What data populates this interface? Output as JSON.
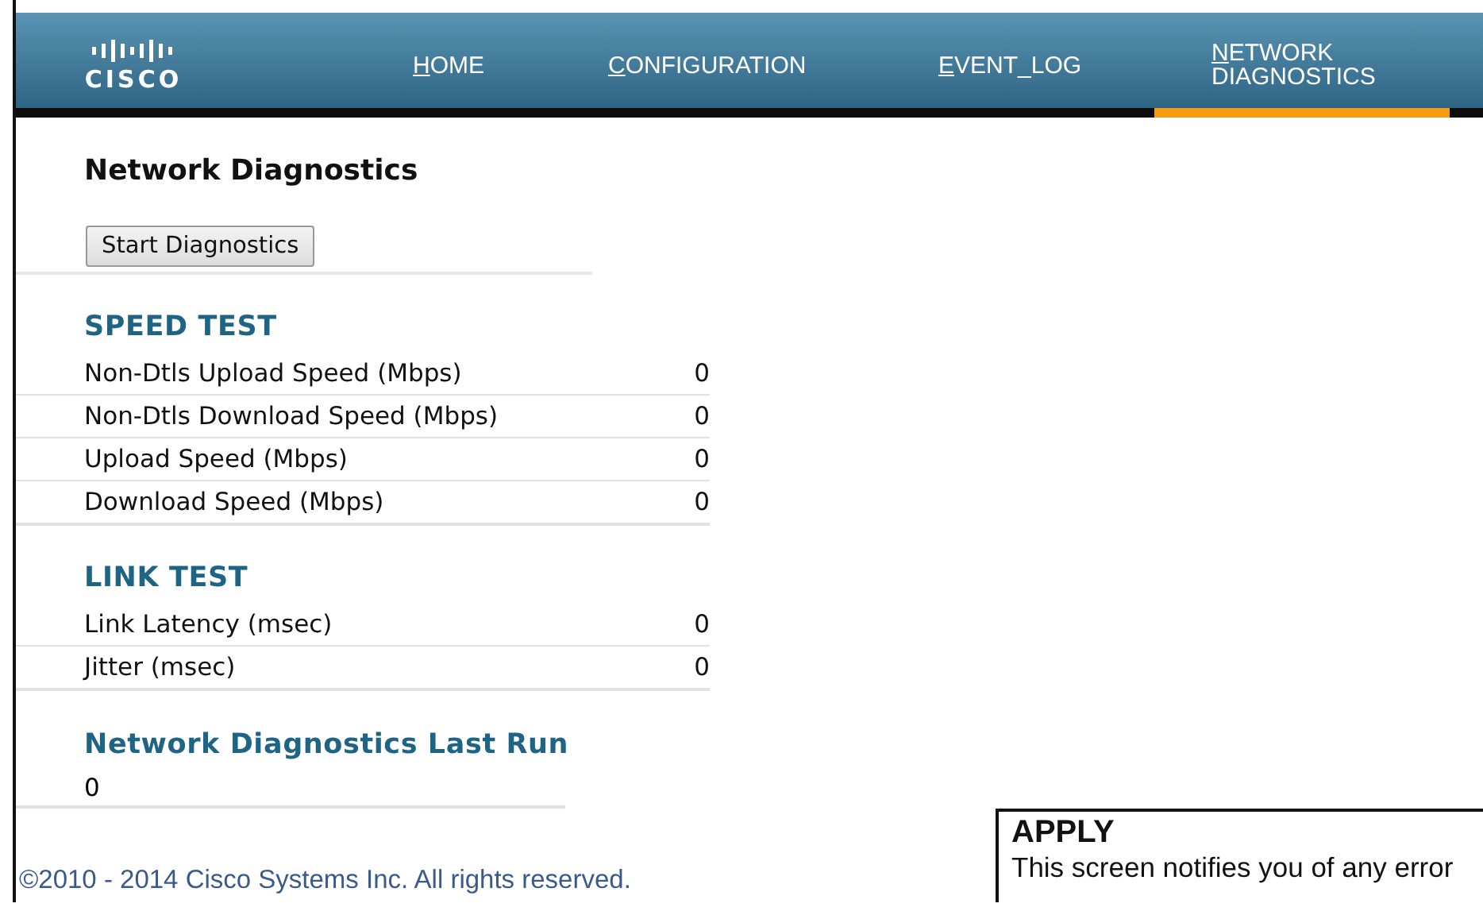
{
  "header": {
    "logo_text": "CISCO",
    "tabs": [
      {
        "label": "HOME",
        "selected": false
      },
      {
        "label": "CONFIGURATION",
        "selected": false
      },
      {
        "label": "EVENT_LOG",
        "selected": false
      },
      {
        "label": "NETWORK DIAGNOSTICS",
        "selected": true
      }
    ]
  },
  "page": {
    "title": "Network Diagnostics",
    "start_button": "Start Diagnostics",
    "sections": [
      {
        "title": "SPEED TEST",
        "rows": [
          {
            "label": "Non-Dtls Upload Speed (Mbps)",
            "value": "0"
          },
          {
            "label": "Non-Dtls Download Speed (Mbps)",
            "value": "0"
          },
          {
            "label": "Upload Speed (Mbps)",
            "value": "0"
          },
          {
            "label": "Download Speed (Mbps)",
            "value": "0"
          }
        ]
      },
      {
        "title": "LINK TEST",
        "rows": [
          {
            "label": "Link Latency (msec)",
            "value": "0"
          },
          {
            "label": "Jitter (msec)",
            "value": "0"
          }
        ]
      }
    ],
    "last_run": {
      "title": "Network Diagnostics Last Run",
      "value": "0"
    }
  },
  "footer": "©2010 - 2014 Cisco Systems Inc. All rights reserved.",
  "apply_popup": {
    "title": "APPLY",
    "text": "This screen notifies you of any error"
  }
}
